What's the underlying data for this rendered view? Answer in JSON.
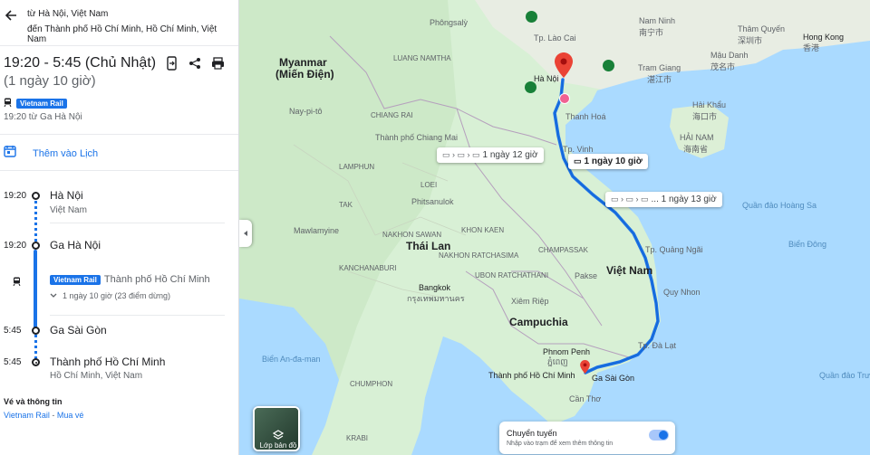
{
  "route": {
    "from_prefix": "từ",
    "from": "Hà Nội, Việt Nam",
    "to_prefix": "đến",
    "to": "Thành phố Hồ Chí Minh, Hồ Chí Minh, Việt Nam"
  },
  "summary": {
    "time_range": "19:20 - 5:45 (Chủ Nhật)",
    "duration": "(1 ngày 10 giờ)",
    "rail_badge": "Vietnam Rail",
    "depart_info": "19:20 từ Ga Hà Nội"
  },
  "add_calendar": "Thêm vào Lịch",
  "timeline": [
    {
      "time": "19:20",
      "title": "Hà Nội",
      "subtitle": "Việt Nam"
    },
    {
      "time": "19:20",
      "title": "Ga Hà Nội",
      "subtitle": ""
    },
    {
      "time": "5:45",
      "title": "Ga Sài Gòn",
      "subtitle": ""
    },
    {
      "time": "5:45",
      "title": "Thành phố Hồ Chí Minh",
      "subtitle": "Hồ Chí Minh, Việt Nam"
    }
  ],
  "segment": {
    "badge": "Vietnam Rail",
    "destination": "Thành phố Hồ Chí Minh",
    "stops": "1 ngày 10 giờ (23 điểm dừng)"
  },
  "footer": {
    "heading": "Vé và thông tin",
    "link1": "Vietnam Rail",
    "sep": " - ",
    "link2": "Mua vé"
  },
  "map": {
    "chips": {
      "alt1": "1 ngày 12 giờ",
      "main": "1 ngày 10 giờ",
      "alt2": "... 1 ngày 13 giờ"
    },
    "countries": {
      "myanmar1": "Myanmar",
      "myanmar2": "(Miến Điện)",
      "thailand": "Thái Lan",
      "vietnam": "Việt Nam",
      "cambodia": "Campuchia"
    },
    "cities": {
      "hanoi": "Hà Nội",
      "hcm": "Thành phố Hồ Chí Minh",
      "gasaigon": "Ga Sài Gòn",
      "namninh": "Nam Ninh",
      "namninh_cn": "南宁市",
      "thamquyen": "Thâm Quyến",
      "thamquyen_cn": "深圳市",
      "hongkong": "Hong Kong",
      "hongkong_cn": "香港",
      "tramgiang": "Tram Giang",
      "tramgiang_cn": "湛江市",
      "maudanh": "Mậu Danh",
      "maudanh_cn": "茂名市",
      "haikhau": "Hải Khẩu",
      "haikhau_cn": "海口市",
      "hainam": "HẢI NAM",
      "hainam_cn": "海南省",
      "thanhhoa": "Thanh Hoá",
      "vinh": "Tp. Vinh",
      "quangngai": "Tp. Quảng Ngãi",
      "quynhon": "Quy Nhon",
      "dalat": "Tp. Đà Lạt",
      "phnompenh": "Phnom Penh",
      "phnompenh_km": "ភ្នំពេញ",
      "bangkok": "Bangkok",
      "bangkok_th": "กรุงเทพมหานคร",
      "cantho": "Cần Thơ",
      "bien_dong": "Biển Đông",
      "laocai": "Tp. Lào Cai",
      "phongsaly": "Phôngsalỳ",
      "luang": "LUANG NAMTHA",
      "chiangmai": "Thành phố Chiang Mai",
      "chiangrai": "CHIANG RAI",
      "lamphun": "LAMPHUN",
      "khonkaen": "KHON KAEN",
      "nakhon": "NAKHON RATCHASIMA",
      "nakhonsawan": "NAKHON SAWAN",
      "kanchanaburi": "KANCHANABURI",
      "siemriep": "Xiêm Riệp",
      "andaman": "Biển An-đa-man",
      "chumphon": "CHUMPHON",
      "krabi": "KRABI",
      "naypyitaw": "Nay-pi-tô",
      "mawlamyine": "Mawlamyine",
      "hoangsa": "Quần đảo Hoàng Sa",
      "truongsa": "Quần đảo Trường Sa",
      "champassak": "CHAMPASSAK",
      "pakse": "Pakse",
      "ubon": "UBON RATCHATHANI",
      "loei": "LOEI",
      "phitsanulok": "Phitsanulok",
      "tak": "TAK"
    },
    "layers_label": "Lớp bản đồ",
    "transfer_title": "Chuyển tuyến",
    "transfer_sub": "Nhập vào trạm để xem thêm thông tin"
  },
  "colors": {
    "route": "#1a73e8",
    "land": "#d4efd4",
    "water": "#aadaff",
    "pin": "#ea4335"
  }
}
